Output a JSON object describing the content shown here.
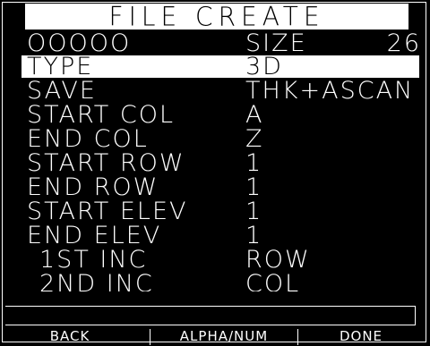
{
  "title": "FILE CREATE",
  "header_row": {
    "name": "OOOOO",
    "size_label": "SIZE",
    "size_value": "26"
  },
  "fields": [
    {
      "label": "TYPE",
      "value": "3D",
      "selected": true
    },
    {
      "label": "SAVE",
      "value": "THK+ASCAN",
      "selected": false
    },
    {
      "label": "START COL",
      "value": "A",
      "selected": false
    },
    {
      "label": "END COL",
      "value": "Z",
      "selected": false
    },
    {
      "label": "START ROW",
      "value": "1",
      "selected": false
    },
    {
      "label": "END ROW",
      "value": "1",
      "selected": false
    },
    {
      "label": "START ELEV",
      "value": "1",
      "selected": false
    },
    {
      "label": "END ELEV",
      "value": "1",
      "selected": false
    },
    {
      "label": "1ST INC",
      "value": "ROW",
      "selected": false
    },
    {
      "label": "2ND INC",
      "value": "COL",
      "selected": false
    }
  ],
  "softkeys": {
    "back": "BACK",
    "alpha_num": "ALPHA/NUM",
    "done": "DONE"
  },
  "colors": {
    "background": "#000000",
    "foreground": "#ffffff",
    "highlight": "#ffffff"
  }
}
